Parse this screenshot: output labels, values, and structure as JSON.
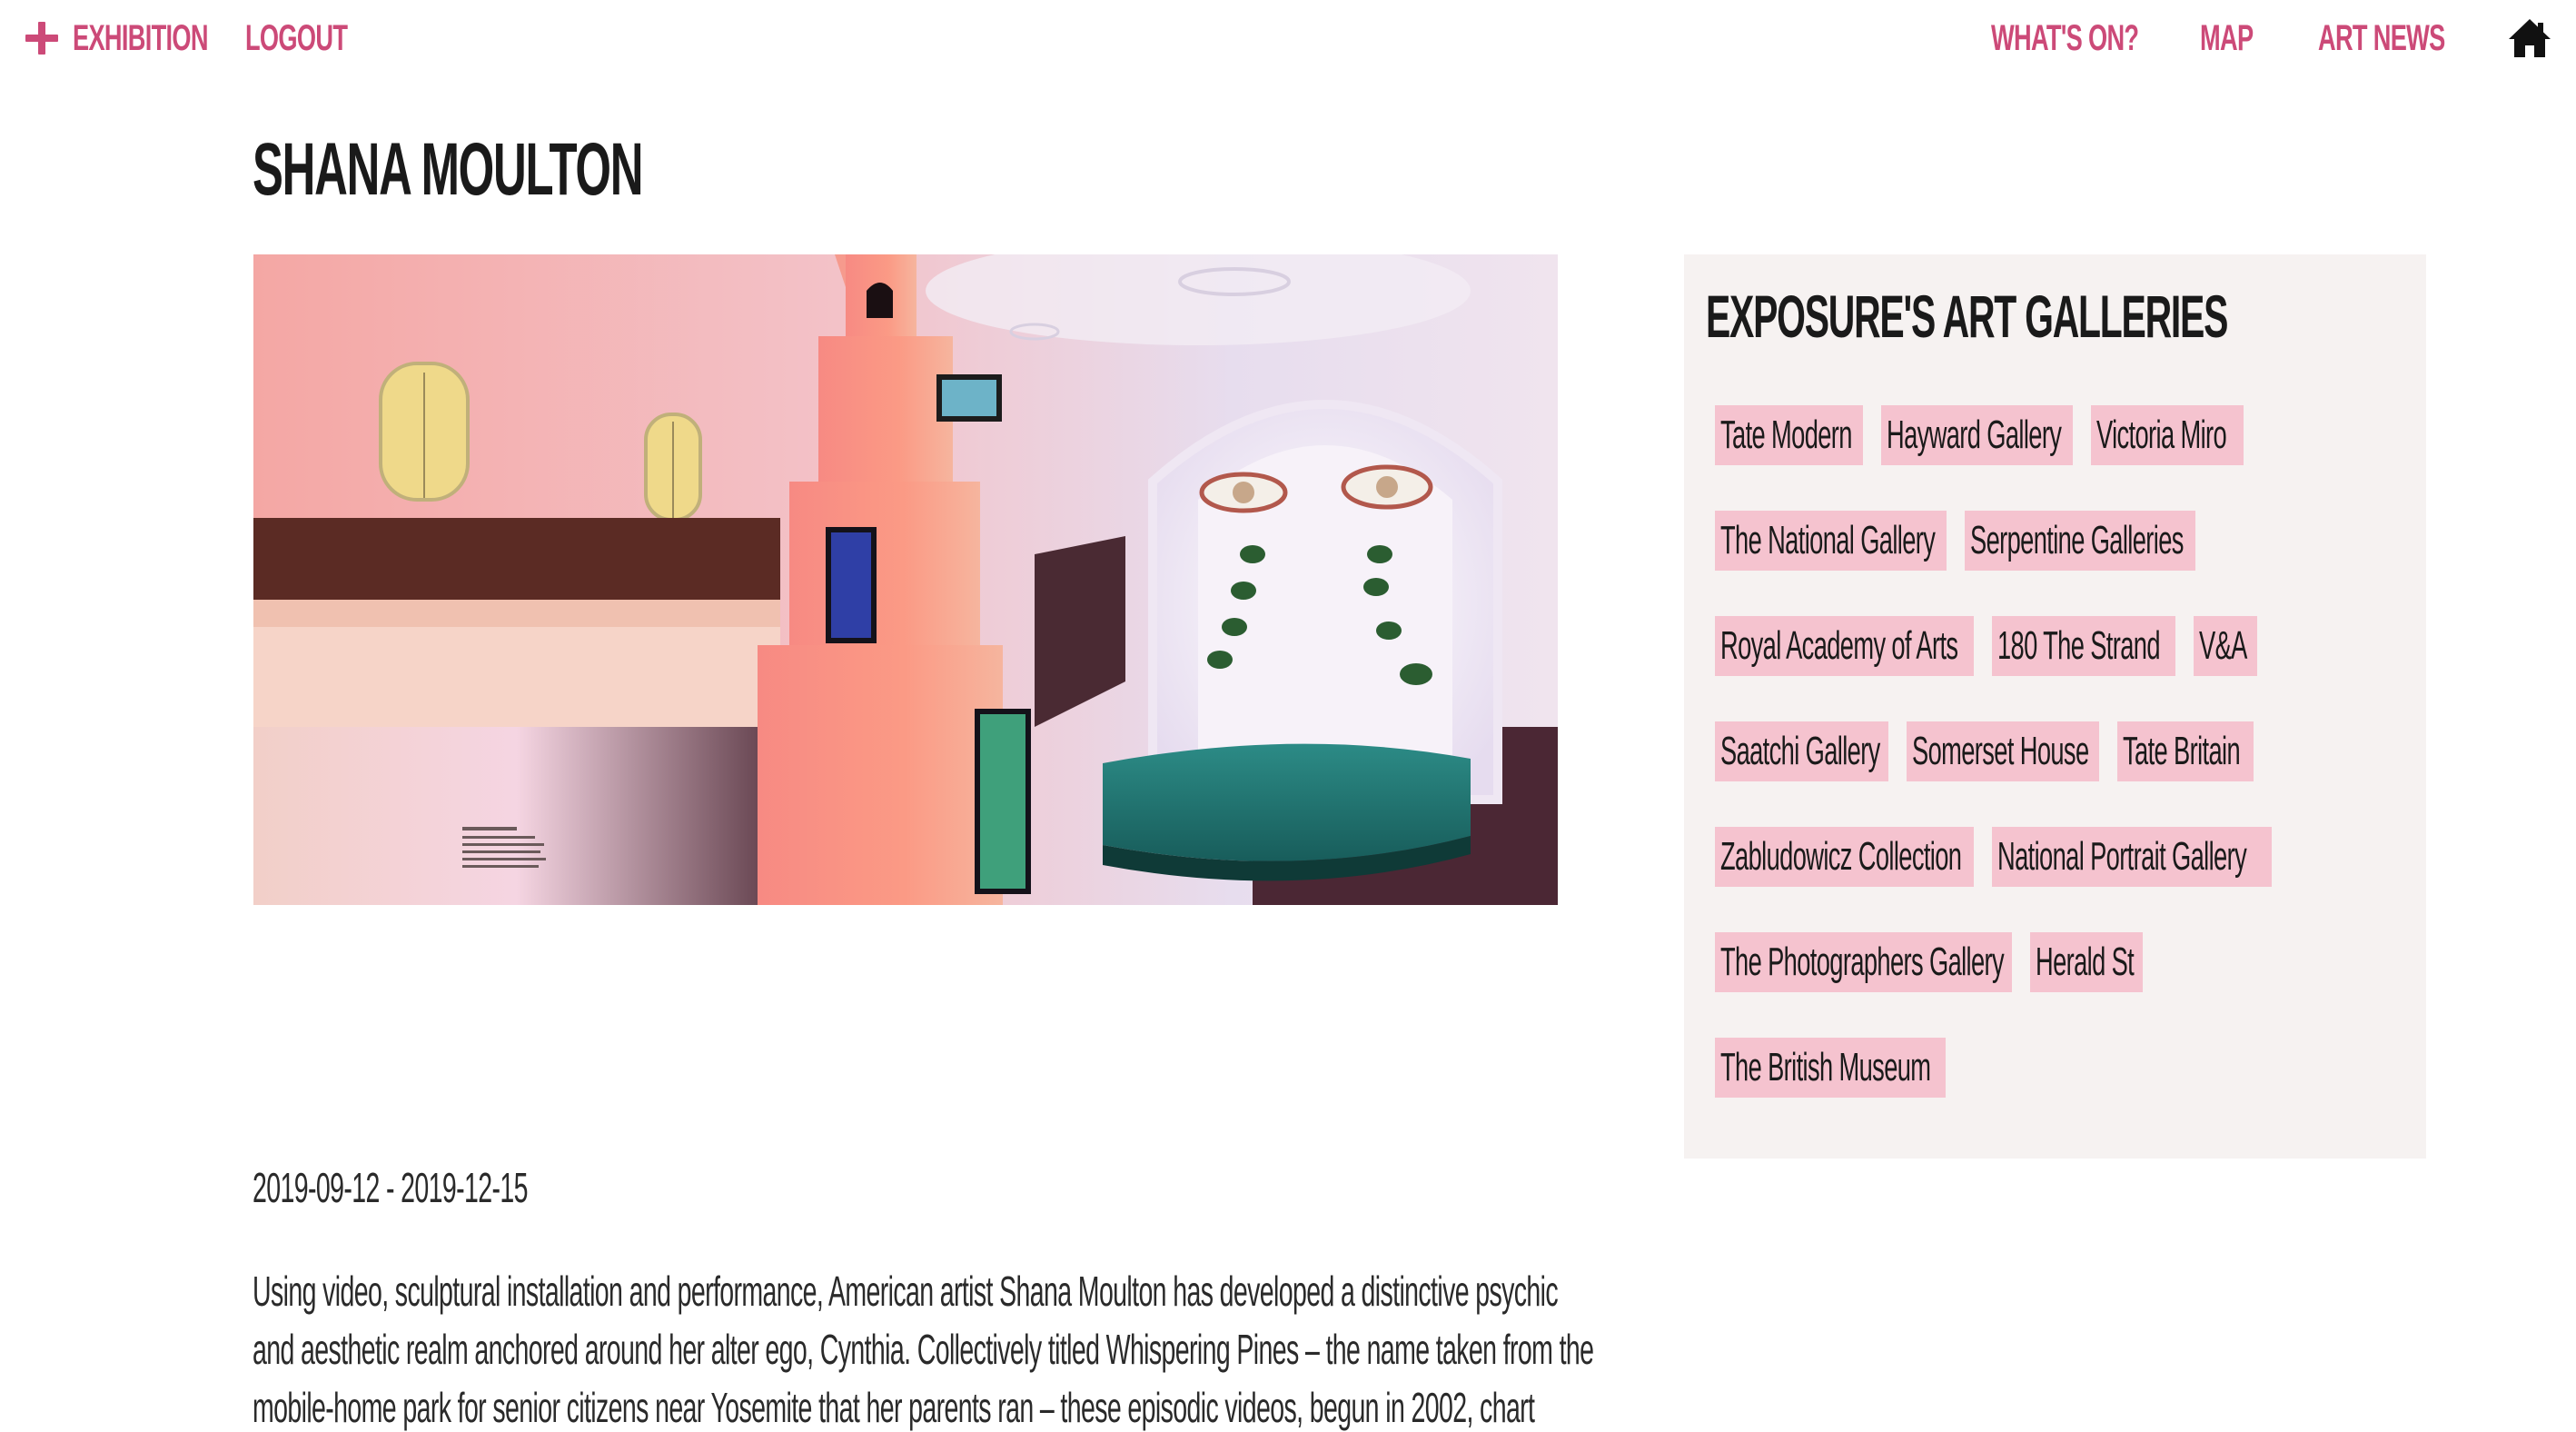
{
  "nav": {
    "exhibition_label": "EXHIBITION",
    "logout_label": "LOGOUT",
    "whats_on_label": "WHAT'S ON?",
    "map_label": "MAP",
    "art_news_label": "ART NEWS"
  },
  "icons": {
    "add": "plus-icon",
    "home": "home-icon"
  },
  "colors": {
    "accent": "#cc4a78",
    "chip": "#f5c3cf",
    "sidebar_bg": "#f6f2f1"
  },
  "exhibition": {
    "title": "SHANA MOULTON",
    "dates": "2019-09-12 - 2019-12-15",
    "description_lines": [
      "Using video, sculptural installation and performance, American artist Shana Moulton has developed a distinctive psychic",
      "and aesthetic realm anchored around her alter ego, Cynthia. Collectively titled Whispering Pines – the name taken from the",
      "mobile-home park for senior citizens near Yosemite that her parents ran – these episodic videos, begun in 2002, chart"
    ]
  },
  "sidebar": {
    "title": "EXPOSURE'S ART GALLERIES",
    "galleries": [
      [
        "Tate Modern",
        "Hayward Gallery",
        "Victoria Miro"
      ],
      [
        "The National Gallery",
        "Serpentine Galleries"
      ],
      [
        "Royal Academy of Arts",
        "180 The Strand",
        "V&A"
      ],
      [
        "Saatchi Gallery",
        "Somerset House",
        "Tate Britain"
      ],
      [
        "Zabludowicz Collection",
        "National Portrait Gallery"
      ],
      [
        "The Photographers Gallery",
        "Herald St"
      ],
      [
        "The British Museum"
      ]
    ]
  }
}
